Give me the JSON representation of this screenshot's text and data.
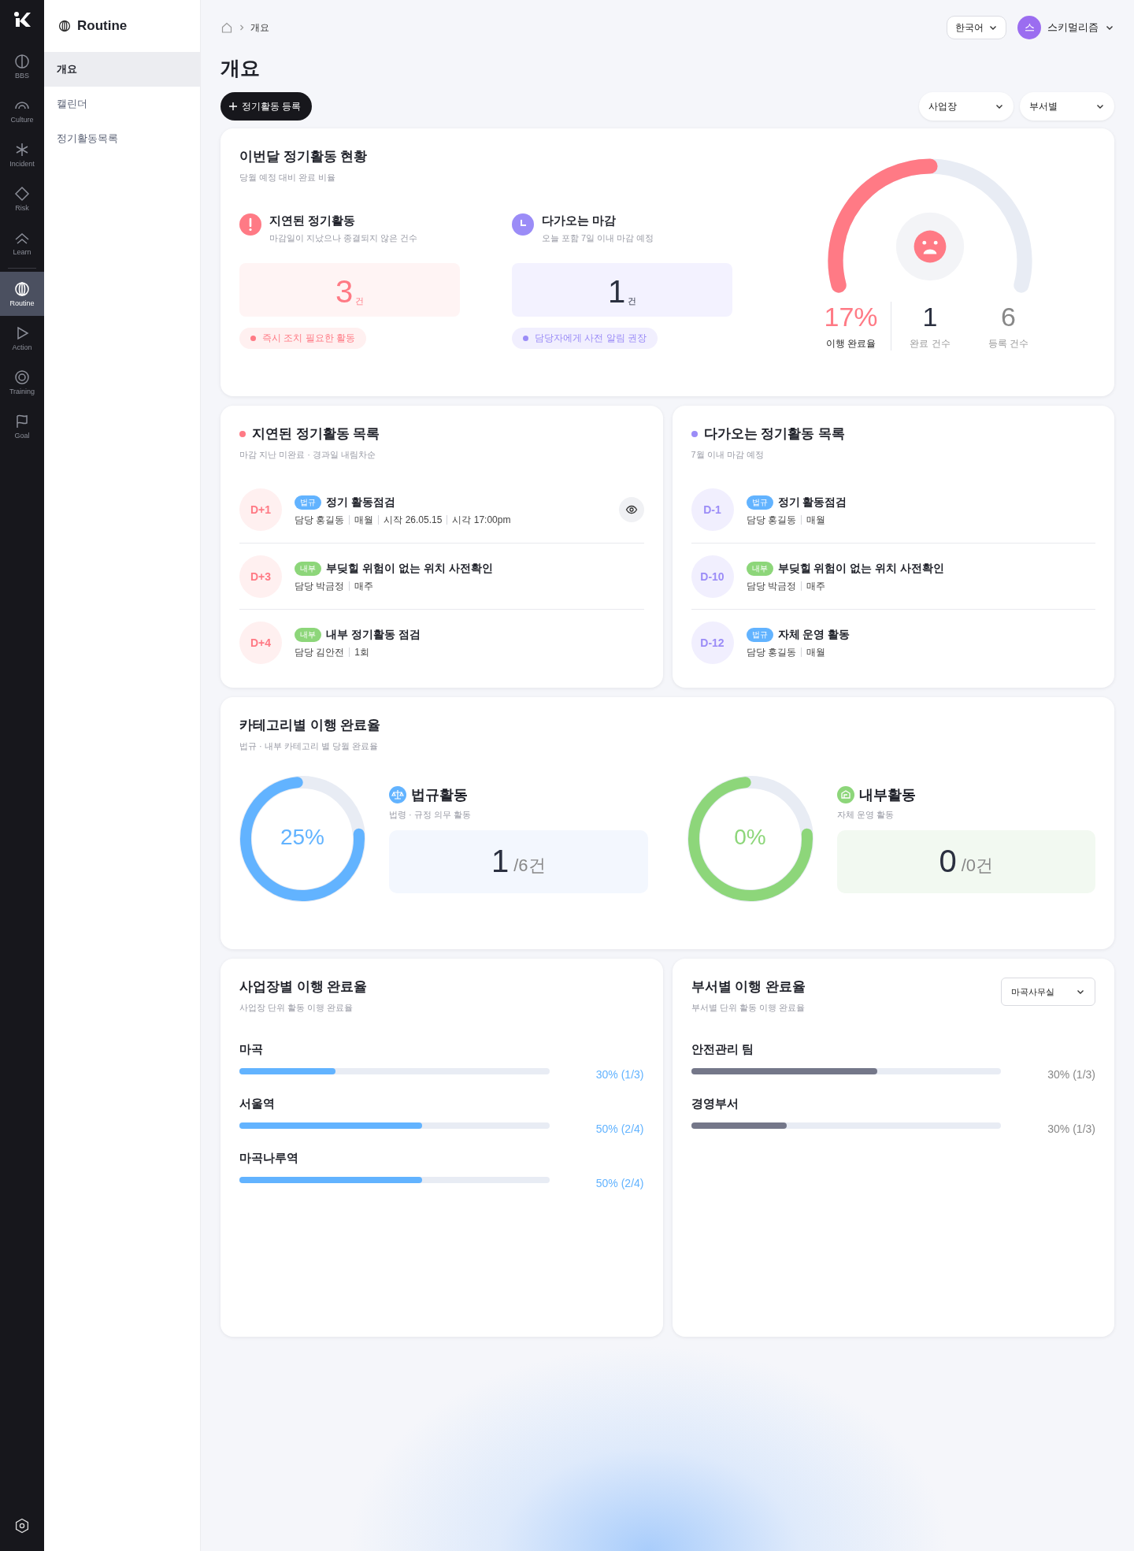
{
  "rail": {
    "items": [
      {
        "label": "BBS",
        "selected": false
      },
      {
        "label": "Culture",
        "selected": false
      },
      {
        "label": "Incident",
        "selected": false
      },
      {
        "label": "Risk",
        "selected": false
      },
      {
        "label": "Learn",
        "selected": false
      },
      {
        "label": "Routine",
        "selected": true
      },
      {
        "label": "Action",
        "selected": false
      },
      {
        "label": "Training",
        "selected": false
      },
      {
        "label": "Goal",
        "selected": false
      }
    ]
  },
  "subnav": {
    "title": "Routine",
    "items": [
      {
        "label": "개요",
        "selected": true
      },
      {
        "label": "캘린더",
        "selected": false
      },
      {
        "label": "정기활동목록",
        "selected": false
      }
    ]
  },
  "header": {
    "breadcrumb": [
      "개요"
    ],
    "language": "한국어",
    "user": {
      "initial": "스",
      "name": "스키멀리즘"
    }
  },
  "page_title": "개요",
  "register_button": "정기활동 등록",
  "filters": [
    "사업장",
    "부서별"
  ],
  "summary": {
    "title": "이번달 정기활동 현황",
    "subtitle": "당월 예정 대비 완료 비율",
    "blocks": [
      {
        "kind": "delayed",
        "title": "지연된 정기활동",
        "subtitle": "마감일이 지났으나 종결되지 않은 건수",
        "count": "3",
        "unit": "건",
        "note": "즉시 조치 필요한 활동"
      },
      {
        "kind": "upcoming",
        "title": "다가오는 마감",
        "subtitle": "오늘 포함 7일 이내 마감 예정",
        "count": "1",
        "unit": "건",
        "note": "담당자에게 사전 알림 권장"
      }
    ],
    "gauge": {
      "level": 0.5,
      "percent": "17%",
      "percent_label": "이행 완료율",
      "stats": [
        {
          "value": "1",
          "label": "완료 건수",
          "kind": "done"
        },
        {
          "value": "6",
          "label": "등록 건수",
          "kind": "total"
        }
      ]
    }
  },
  "lists": [
    {
      "kind": "delayed",
      "title": "지연된 정기활동 목록",
      "subtitle": "마감 지난 미완료 · 경과일 내림차순",
      "items": [
        {
          "dday": "D+1",
          "tag": {
            "label": "법규",
            "kind": "legal"
          },
          "title": "정기 활동점검",
          "meta": [
            "담당 홍길동",
            "매월",
            "시작 26.05.15",
            "시각 17:00pm"
          ],
          "view_button": true
        },
        {
          "dday": "D+3",
          "tag": {
            "label": "내부",
            "kind": "internal"
          },
          "title": "부딪힐 위험이 없는 위치 사전확인",
          "meta": [
            "담당 박금정",
            "매주"
          ],
          "view_button": false
        },
        {
          "dday": "D+4",
          "tag": {
            "label": "내부",
            "kind": "internal"
          },
          "title": "내부 정기활동 점검",
          "meta": [
            "담당 김안전",
            "1회"
          ],
          "view_button": false
        }
      ]
    },
    {
      "kind": "upcoming",
      "title": "다가오는 정기활동 목록",
      "subtitle": "7월 이내 마감 예정",
      "items": [
        {
          "dday": "D-1",
          "tag": {
            "label": "법규",
            "kind": "legal"
          },
          "title": "정기 활동점검",
          "meta": [
            "담당 홍길동",
            "매월"
          ],
          "view_button": false
        },
        {
          "dday": "D-10",
          "tag": {
            "label": "내부",
            "kind": "internal"
          },
          "title": "부딪힐 위험이 없는 위치 사전확인",
          "meta": [
            "담당 박금정",
            "매주"
          ],
          "view_button": false
        },
        {
          "dday": "D-12",
          "tag": {
            "label": "법규",
            "kind": "legal"
          },
          "title": "자체 운영 활동",
          "meta": [
            "담당 홍길동",
            "매월"
          ],
          "view_button": false
        }
      ]
    }
  ],
  "category": {
    "title": "카테고리별 이행 완료율",
    "subtitle": "법규 · 내부 카테고리 별 당월 완료율",
    "items": [
      {
        "kind": "legal",
        "level": 0.75,
        "percent": "25%",
        "title": "법규활동",
        "subtitle": "법령 · 규정 의무 활동",
        "count": "1",
        "total": "/6건"
      },
      {
        "kind": "internal",
        "level": 0.75,
        "percent": "0%",
        "title": "내부활동",
        "subtitle": "자체 운영 활동",
        "count": "0",
        "total": "/0건"
      }
    ]
  },
  "site_rates": {
    "title": "사업장별 이행 완료율",
    "subtitle": "사업장 단위 활동 이행 완료율",
    "rows": [
      {
        "label": "마곡",
        "level": 0.31,
        "reading": "30% (1/3)"
      },
      {
        "label": "서울역",
        "level": 0.59,
        "reading": "50% (2/4)"
      },
      {
        "label": "마곡나루역",
        "level": 0.59,
        "reading": "50% (2/4)"
      }
    ]
  },
  "dept_rates": {
    "title": "부서별 이행 완료율",
    "subtitle": "부서별 단위 활동 이행 완료율",
    "select": "마곡사무실",
    "rows": [
      {
        "label": "안전관리 팀",
        "level": 0.6,
        "reading": "30% (1/3)"
      },
      {
        "label": "경영부서",
        "level": 0.31,
        "reading": "30% (1/3)"
      }
    ]
  }
}
